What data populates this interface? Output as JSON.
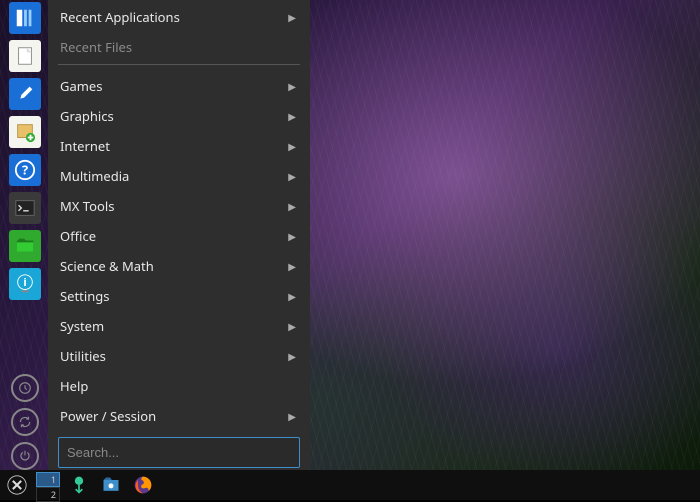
{
  "menu": {
    "recent_apps": "Recent Applications",
    "recent_files": "Recent Files",
    "categories": [
      "Games",
      "Graphics",
      "Internet",
      "Multimedia",
      "MX Tools",
      "Office",
      "Science & Math",
      "Settings",
      "System",
      "Utilities",
      "Help",
      "Power / Session"
    ],
    "no_submenu": [
      "Help"
    ],
    "search_placeholder": "Search..."
  },
  "launcher": {
    "icons": [
      {
        "name": "file-manager-icon",
        "bg": "#1a6fd6"
      },
      {
        "name": "document-icon",
        "bg": "#f5f5f0"
      },
      {
        "name": "tools-icon",
        "bg": "#1a6fd6"
      },
      {
        "name": "package-install-icon",
        "bg": "#f5f5f0"
      },
      {
        "name": "help-icon",
        "bg": "#1a6fd6"
      },
      {
        "name": "terminal-icon",
        "bg": "#3a3a3a"
      },
      {
        "name": "folder-app-icon",
        "bg": "#2faa2f"
      },
      {
        "name": "system-info-icon",
        "bg": "#1aa6d6"
      }
    ],
    "session": [
      {
        "name": "recent-icon"
      },
      {
        "name": "refresh-icon"
      },
      {
        "name": "power-icon"
      }
    ]
  },
  "taskbar": {
    "start": "MX",
    "workspaces": [
      "1",
      "2"
    ],
    "active_workspace": 0,
    "pinned": [
      {
        "name": "updater-icon"
      },
      {
        "name": "files-icon"
      },
      {
        "name": "firefox-icon"
      }
    ]
  }
}
